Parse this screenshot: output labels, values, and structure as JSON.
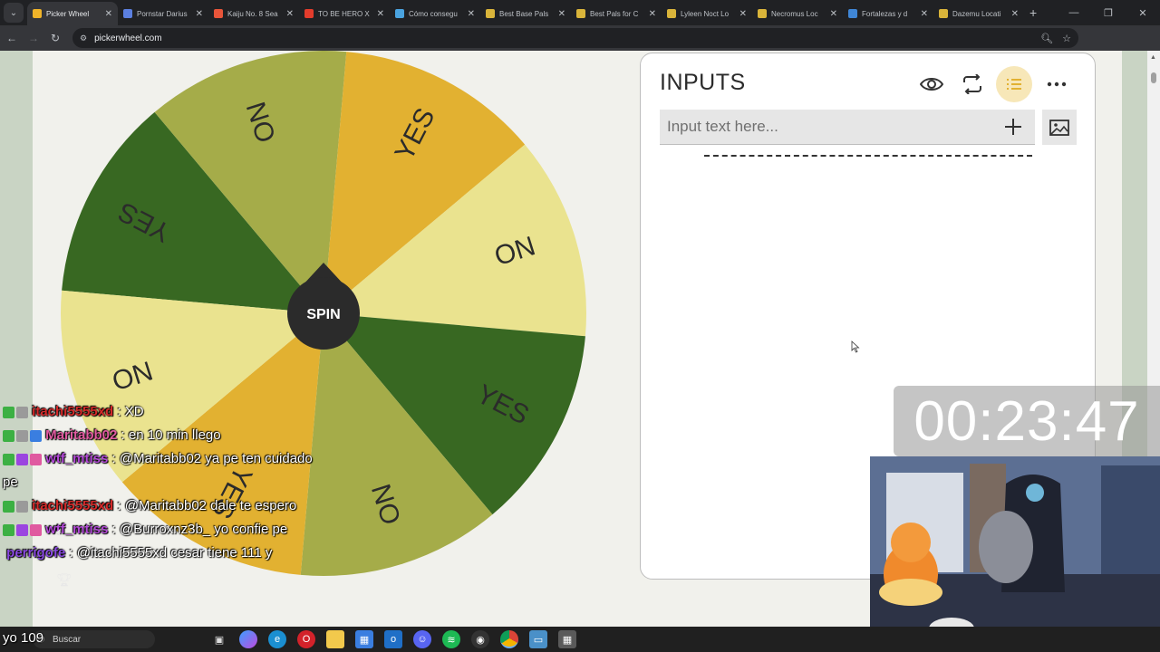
{
  "browser": {
    "tabs": [
      {
        "title": "Picker Wheel",
        "color": "#f0b429",
        "active": true
      },
      {
        "title": "Pornstar Darius",
        "color": "#5b7fe0",
        "active": false
      },
      {
        "title": "Kaiju No. 8 Sea",
        "color": "#e8553a",
        "active": false
      },
      {
        "title": "TO BE HERO X",
        "color": "#e33c2c",
        "active": false
      },
      {
        "title": "Cómo consegu",
        "color": "#4aa3df",
        "active": false
      },
      {
        "title": "Best Base Pals",
        "color": "#d9b43a",
        "active": false
      },
      {
        "title": "Best Pals for C",
        "color": "#d9b43a",
        "active": false
      },
      {
        "title": "Lyleen Noct Lo",
        "color": "#d9b43a",
        "active": false
      },
      {
        "title": "Necromus Loc",
        "color": "#d9b43a",
        "active": false
      },
      {
        "title": "Fortalezas y d",
        "color": "#3f86d6",
        "active": false
      },
      {
        "title": "Dazemu Locati",
        "color": "#d9b43a",
        "active": false
      }
    ],
    "url": "pickerwheel.com"
  },
  "wheel": {
    "spin_label": "SPIN",
    "colors": {
      "dark_green": "#386822",
      "olive": "#a5ac49",
      "gold": "#e2b131",
      "pale": "#eae38f",
      "hub": "#2b2b2b"
    },
    "segments": [
      {
        "label": "YES",
        "color": "dark_green"
      },
      {
        "label": "ON",
        "color": "olive"
      },
      {
        "label": "YES",
        "color": "gold"
      },
      {
        "label": "ON",
        "color": "pale"
      },
      {
        "label": "YES",
        "color": "dark_green"
      },
      {
        "label": "NO",
        "color": "olive"
      },
      {
        "label": "YES",
        "color": "gold"
      },
      {
        "label": "NO",
        "color": "pale"
      }
    ]
  },
  "inputs_panel": {
    "title": "INPUTS",
    "input_placeholder": "Input text here...",
    "accent_active": "#f7e7b8"
  },
  "timer": {
    "value": "00:23:47"
  },
  "chat": [
    {
      "user": "itachi5555xd",
      "user_color": "#d42a2a",
      "text": ": XD",
      "badges": [
        "#3cb043",
        "#9a9a9a"
      ]
    },
    {
      "user": "Maritabb02",
      "user_color": "#e05aa0",
      "text": ": en 10 min llego",
      "badges": [
        "#3cb043",
        "#9a9a9a",
        "#3a7ee0"
      ]
    },
    {
      "user": "wtf_mtiss",
      "user_color": "#b44ad8",
      "text": ": @Maritabb02 ya pe ten cuidado pe",
      "badges": [
        "#3cb043",
        "#9b45e0",
        "#e05aa0"
      ]
    },
    {
      "user": "itachi5555xd",
      "user_color": "#d42a2a",
      "text": ": @Maritabb02 dale te espero",
      "badges": [
        "#3cb043",
        "#9a9a9a"
      ]
    },
    {
      "user": "wtf_mtiss",
      "user_color": "#b44ad8",
      "text": ": @Burroxnz3b_ yo confie pe",
      "badges": [
        "#3cb043",
        "#9b45e0",
        "#e05aa0"
      ]
    },
    {
      "user": "perrigofe",
      "user_color": "#8a4ae0",
      "text": ": @itachi5555xd cesar tiene 111 y",
      "badges": []
    }
  ],
  "chat_tail": "yo 109",
  "taskbar": {
    "search_label": "Buscar"
  }
}
